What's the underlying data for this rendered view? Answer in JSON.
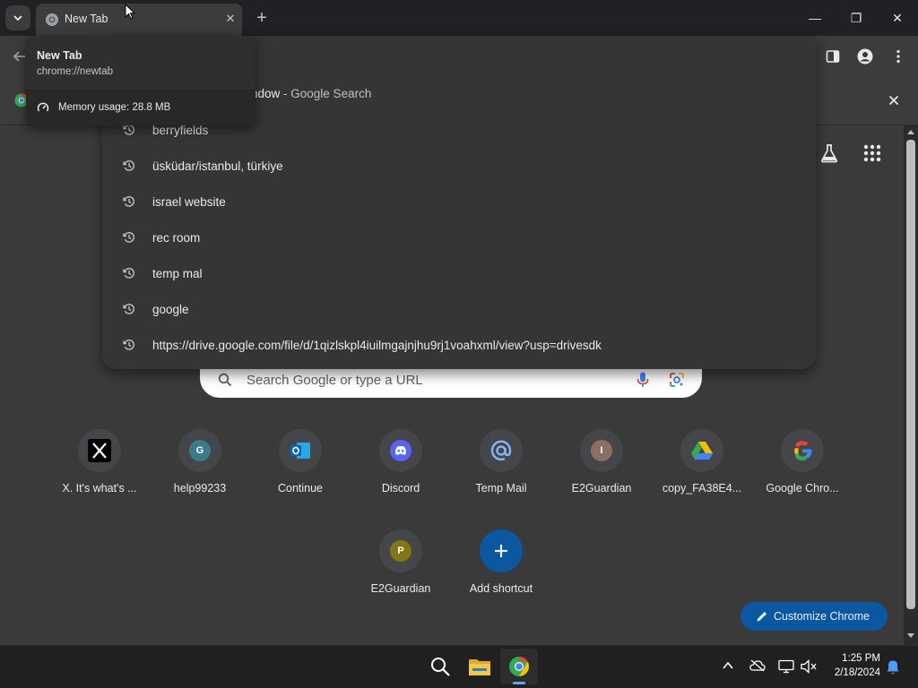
{
  "browser": {
    "tab": {
      "title": "New Tab",
      "close_glyph": "✕"
    },
    "new_tab_glyph": "+",
    "window_controls": {
      "minimize": "—",
      "maximize": "❐",
      "close": "✕"
    }
  },
  "tooltip": {
    "title": "New Tab",
    "url": "chrome://newtab",
    "memory": "Memory usage: 28.8 MB"
  },
  "omnibox": {
    "top_suggestion": {
      "visible_text": "ndow",
      "suffix": " - Google Search"
    },
    "suggestions": [
      "berryfields",
      "üsküdar/istanbul, türkiye",
      "israel website",
      "rec room",
      "temp mal",
      "google",
      "https://drive.google.com/file/d/1qizlskpl4iuilmgajnjhu9rj1voahxml/view?usp=drivesdk"
    ]
  },
  "search": {
    "placeholder": "Search Google or type a URL"
  },
  "shortcuts": [
    {
      "label": "X. It's what's ...",
      "icon": "x-logo-icon",
      "letter": ""
    },
    {
      "label": "help99233",
      "icon": "letter-icon",
      "letter": "G",
      "color": "#3b7a8c"
    },
    {
      "label": "Continue",
      "icon": "outlook-icon",
      "letter": ""
    },
    {
      "label": "Discord",
      "icon": "discord-icon",
      "letter": ""
    },
    {
      "label": "Temp Mail",
      "icon": "at-sign-icon",
      "letter": ""
    },
    {
      "label": "E2Guardian",
      "icon": "letter-icon",
      "letter": "I",
      "color": "#8d6e63"
    },
    {
      "label": "copy_FA38E4...",
      "icon": "google-drive-icon",
      "letter": ""
    },
    {
      "label": "Google Chro...",
      "icon": "google-g-icon",
      "letter": ""
    },
    {
      "label": "E2Guardian",
      "icon": "letter-icon",
      "letter": "P",
      "color": "#827717"
    },
    {
      "label": "Add shortcut",
      "icon": "plus-icon",
      "letter": "+"
    }
  ],
  "customize": {
    "label": "Customize Chrome"
  },
  "taskbar": {
    "time": "1:25 PM",
    "date": "2/18/2024"
  },
  "colors": {
    "accent": "#0b57a0",
    "tab": "#3c3c3c",
    "background": "#3a3a3a"
  }
}
